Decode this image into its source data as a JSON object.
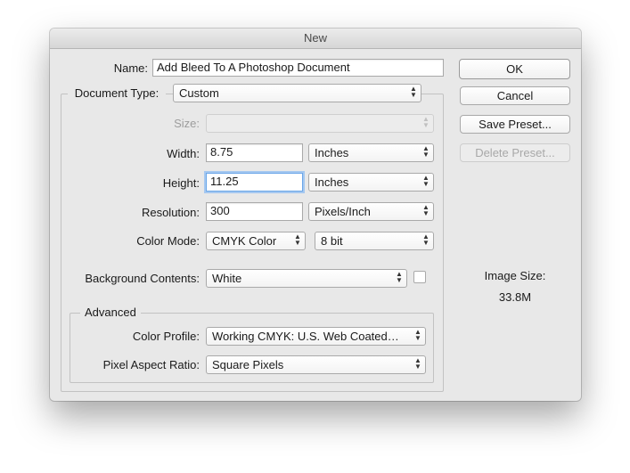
{
  "window": {
    "title": "New"
  },
  "form": {
    "name_label": "Name:",
    "name_value": "Add Bleed To A Photoshop Document",
    "document_type_label": "Document Type:",
    "document_type_value": "Custom",
    "size_label": "Size:",
    "size_value": "",
    "width_label": "Width:",
    "width_value": "8.75",
    "width_unit": "Inches",
    "height_label": "Height:",
    "height_value": "11.25",
    "height_unit": "Inches",
    "resolution_label": "Resolution:",
    "resolution_value": "300",
    "resolution_unit": "Pixels/Inch",
    "color_mode_label": "Color Mode:",
    "color_mode_value": "CMYK Color",
    "bit_depth_value": "8 bit",
    "background_label": "Background Contents:",
    "background_value": "White",
    "advanced_label": "Advanced",
    "color_profile_label": "Color Profile:",
    "color_profile_value": "Working CMYK:  U.S. Web Coated…",
    "pixel_aspect_label": "Pixel Aspect Ratio:",
    "pixel_aspect_value": "Square Pixels"
  },
  "buttons": {
    "ok": "OK",
    "cancel": "Cancel",
    "save_preset": "Save Preset...",
    "delete_preset": "Delete Preset..."
  },
  "image_size": {
    "label": "Image Size:",
    "value": "33.8M"
  },
  "icons": {
    "select_arrows": "up-down-chevron-icon"
  },
  "colors": {
    "focus_ring": "#a5c8f0",
    "dialog_bg": "#e8e8e8"
  }
}
